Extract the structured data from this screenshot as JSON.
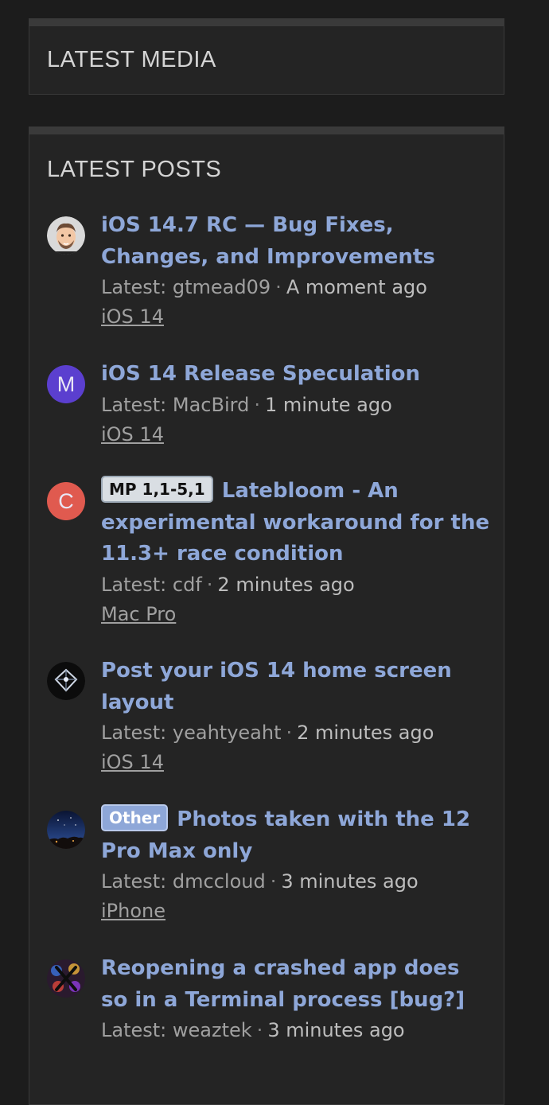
{
  "media_block": {
    "title": "LATEST MEDIA"
  },
  "posts_block": {
    "title": "LATEST POSTS",
    "latest_prefix": "Latest: ",
    "separator": "·",
    "posts": [
      {
        "title": "iOS 14.7 RC — Bug Fixes, Changes, and Improvements",
        "prefix": "",
        "user": "gtmead09",
        "time": "A moment ago",
        "forum": "iOS 14",
        "avatar": {
          "type": "memoji",
          "bg": "#d9d9d9"
        }
      },
      {
        "title": "iOS 14 Release Speculation",
        "prefix": "",
        "user": "MacBird",
        "time": "1 minute ago",
        "forum": "iOS 14",
        "avatar": {
          "type": "letter",
          "letter": "M",
          "bg": "#5b3fcf"
        }
      },
      {
        "title": "Latebloom - An experimental workaround for the 11.3+ race condition",
        "prefix": "MP 1,1-5,1",
        "user": "cdf",
        "time": "2 minutes ago",
        "forum": "Mac Pro",
        "avatar": {
          "type": "letter",
          "letter": "C",
          "bg": "#e05a4f"
        }
      },
      {
        "title": "Post your iOS 14 home screen layout",
        "prefix": "",
        "user": "yeahtyeaht",
        "time": "2 minutes ago",
        "forum": "iOS 14",
        "avatar": {
          "type": "cube-logo",
          "bg": "#0c0c0c"
        }
      },
      {
        "title": "Photos taken with the 12 Pro Max only",
        "prefix": "Other",
        "user": "dmccloud",
        "time": "3 minutes ago",
        "forum": "iPhone",
        "avatar": {
          "type": "night-sky",
          "bg": "#10204a"
        }
      },
      {
        "title": "Reopening a crashed app does so in a Terminal process [bug?]",
        "prefix": "",
        "user": "weaztek",
        "time": "3 minutes ago",
        "forum": "",
        "avatar": {
          "type": "colorful-x",
          "bg": "#2a1a2e"
        }
      }
    ]
  },
  "colors": {
    "page_bg": "#1c1c1c",
    "block_bg": "#242424",
    "link": "#8ea7d8",
    "muted_text": "#a0a0a0"
  }
}
